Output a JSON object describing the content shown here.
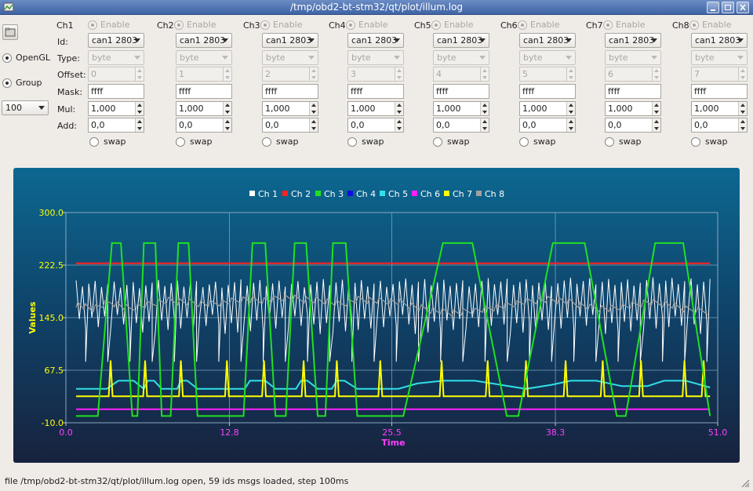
{
  "window": {
    "title": "/tmp/obd2-bt-stm32/qt/plot/illum.log"
  },
  "left_panel": {
    "opengl_label": "OpenGL",
    "group_label": "Group",
    "step_value": "100"
  },
  "row_labels": {
    "id": "Id:",
    "type": "Type:",
    "offset": "Offset:",
    "mask": "Mask:",
    "mul": "Mul:",
    "add": "Add:"
  },
  "channels": [
    {
      "name": "Ch1",
      "enable": "Enable",
      "id": "can1 2803",
      "type": "byte",
      "offset": "0",
      "mask": "ffff",
      "mul": "1,000",
      "add": "0,0",
      "swap": "swap"
    },
    {
      "name": "Ch2",
      "enable": "Enable",
      "id": "can1 2803",
      "type": "byte",
      "offset": "1",
      "mask": "ffff",
      "mul": "1,000",
      "add": "0,0",
      "swap": "swap"
    },
    {
      "name": "Ch3",
      "enable": "Enable",
      "id": "can1 2803",
      "type": "byte",
      "offset": "2",
      "mask": "ffff",
      "mul": "1,000",
      "add": "0,0",
      "swap": "swap"
    },
    {
      "name": "Ch4",
      "enable": "Enable",
      "id": "can1 2803",
      "type": "byte",
      "offset": "3",
      "mask": "ffff",
      "mul": "1,000",
      "add": "0,0",
      "swap": "swap"
    },
    {
      "name": "Ch5",
      "enable": "Enable",
      "id": "can1 2803",
      "type": "byte",
      "offset": "4",
      "mask": "ffff",
      "mul": "1,000",
      "add": "0,0",
      "swap": "swap"
    },
    {
      "name": "Ch6",
      "enable": "Enable",
      "id": "can1 2803",
      "type": "byte",
      "offset": "5",
      "mask": "ffff",
      "mul": "1,000",
      "add": "0,0",
      "swap": "swap"
    },
    {
      "name": "Ch7",
      "enable": "Enable",
      "id": "can1 2803",
      "type": "byte",
      "offset": "6",
      "mask": "ffff",
      "mul": "1,000",
      "add": "0,0",
      "swap": "swap"
    },
    {
      "name": "Ch8",
      "enable": "Enable",
      "id": "can1 2803",
      "type": "byte",
      "offset": "7",
      "mask": "ffff",
      "mul": "1,000",
      "add": "0,0",
      "swap": "swap"
    }
  ],
  "chart_data": {
    "type": "line",
    "xlabel": "Time",
    "ylabel": "Values",
    "xlim": [
      0.0,
      51.0
    ],
    "ylim": [
      -10.0,
      300.0
    ],
    "x_ticks": [
      "0.0",
      "12.8",
      "25.5",
      "38.3",
      "51.0"
    ],
    "y_ticks": [
      "-10.0",
      "67.5",
      "145.0",
      "222.5",
      "300.0"
    ],
    "legend_position": "top-center",
    "grid": true,
    "colors": {
      "Ch 1": "#ffffff",
      "Ch 2": "#ff2020",
      "Ch 3": "#20e020",
      "Ch 4": "#1010e0",
      "Ch 5": "#30e0e8",
      "Ch 6": "#ff20ff",
      "Ch 7": "#ffff00",
      "Ch 8": "#a0a0a0"
    },
    "series": [
      {
        "name": "Ch 1",
        "segments": [
          [
            0.8,
            80,
            200
          ],
          [
            50.4,
            80,
            205
          ]
        ]
      },
      {
        "name": "Ch 2",
        "values": [
          [
            0.8,
            225
          ],
          [
            50.4,
            225
          ]
        ]
      },
      {
        "name": "Ch 3",
        "values": [
          [
            0.8,
            0
          ],
          [
            2.5,
            0
          ],
          [
            3.6,
            255
          ],
          [
            4.3,
            255
          ],
          [
            5.2,
            0
          ],
          [
            5.6,
            0
          ],
          [
            6.1,
            255
          ],
          [
            7.0,
            255
          ],
          [
            7.5,
            0
          ],
          [
            8.2,
            0
          ],
          [
            8.8,
            255
          ],
          [
            9.6,
            255
          ],
          [
            10.3,
            0
          ],
          [
            13.9,
            0
          ],
          [
            14.6,
            255
          ],
          [
            15.6,
            255
          ],
          [
            16.4,
            0
          ],
          [
            17.2,
            0
          ],
          [
            17.9,
            255
          ],
          [
            18.8,
            255
          ],
          [
            19.7,
            0
          ],
          [
            20.3,
            0
          ],
          [
            20.9,
            255
          ],
          [
            21.9,
            255
          ],
          [
            22.8,
            0
          ],
          [
            26.4,
            0
          ],
          [
            29.5,
            255
          ],
          [
            31.8,
            255
          ],
          [
            34.5,
            0
          ],
          [
            35.4,
            0
          ],
          [
            38.1,
            255
          ],
          [
            40.6,
            255
          ],
          [
            43.1,
            0
          ],
          [
            43.8,
            0
          ],
          [
            46.1,
            255
          ],
          [
            48.3,
            255
          ],
          [
            50.4,
            0
          ]
        ]
      },
      {
        "name": "Ch 4",
        "values": []
      },
      {
        "name": "Ch 5",
        "values": [
          [
            0.8,
            40
          ],
          [
            3.2,
            40
          ],
          [
            4.1,
            52
          ],
          [
            5.3,
            52
          ],
          [
            6.1,
            40
          ],
          [
            6.4,
            52
          ],
          [
            6.9,
            52
          ],
          [
            7.5,
            40
          ],
          [
            8.7,
            40
          ],
          [
            9.0,
            52
          ],
          [
            9.5,
            52
          ],
          [
            10.3,
            40
          ],
          [
            14.0,
            40
          ],
          [
            14.4,
            52
          ],
          [
            15.6,
            52
          ],
          [
            16.4,
            40
          ],
          [
            18.0,
            40
          ],
          [
            18.4,
            52
          ],
          [
            18.9,
            52
          ],
          [
            19.7,
            40
          ],
          [
            20.8,
            40
          ],
          [
            21.2,
            52
          ],
          [
            21.8,
            52
          ],
          [
            22.8,
            40
          ],
          [
            26.0,
            40
          ],
          [
            27.5,
            48
          ],
          [
            29.5,
            52
          ],
          [
            32.0,
            52
          ],
          [
            34.0,
            46
          ],
          [
            36.0,
            40
          ],
          [
            38.0,
            46
          ],
          [
            39.5,
            52
          ],
          [
            41.5,
            52
          ],
          [
            43.5,
            44
          ],
          [
            45.5,
            44
          ],
          [
            46.8,
            52
          ],
          [
            48.5,
            52
          ],
          [
            50.4,
            42
          ]
        ]
      },
      {
        "name": "Ch 6",
        "values": [
          [
            0.8,
            10
          ],
          [
            50.4,
            10
          ]
        ]
      },
      {
        "name": "Ch 7",
        "baseline": 29,
        "spikes": [
          3.5,
          6.2,
          9.0,
          12.6,
          15.5,
          18.6,
          21.2,
          24.6,
          29.4,
          33.0,
          36.0,
          39.1,
          42.0,
          45.0,
          48.4,
          49.9
        ],
        "spike_height": 82
      },
      {
        "name": "Ch 8",
        "values": [
          [
            0.8,
            165
          ],
          [
            2.0,
            158
          ],
          [
            3.5,
            168
          ],
          [
            5.0,
            158
          ],
          [
            6.5,
            165
          ],
          [
            8.0,
            170
          ],
          [
            9.5,
            168
          ],
          [
            11.0,
            165
          ],
          [
            12.5,
            168
          ],
          [
            14.0,
            172
          ],
          [
            15.5,
            170
          ],
          [
            17.0,
            175
          ],
          [
            18.5,
            172
          ],
          [
            20.0,
            170
          ],
          [
            21.5,
            165
          ],
          [
            23.0,
            172
          ],
          [
            24.5,
            170
          ],
          [
            26.0,
            168
          ],
          [
            27.5,
            160
          ],
          [
            29.0,
            155
          ],
          [
            30.5,
            152
          ],
          [
            32.0,
            155
          ],
          [
            33.5,
            160
          ],
          [
            35.0,
            165
          ],
          [
            36.5,
            170
          ],
          [
            38.0,
            172
          ],
          [
            39.5,
            168
          ],
          [
            41.0,
            160
          ],
          [
            42.5,
            158
          ],
          [
            44.0,
            162
          ],
          [
            45.5,
            168
          ],
          [
            47.0,
            165
          ],
          [
            48.5,
            158
          ],
          [
            50.4,
            152
          ]
        ]
      }
    ]
  },
  "status": {
    "message": "file /tmp/obd2-bt-stm32/qt/plot/illum.log open, 59 ids msgs loaded, step 100ms"
  }
}
